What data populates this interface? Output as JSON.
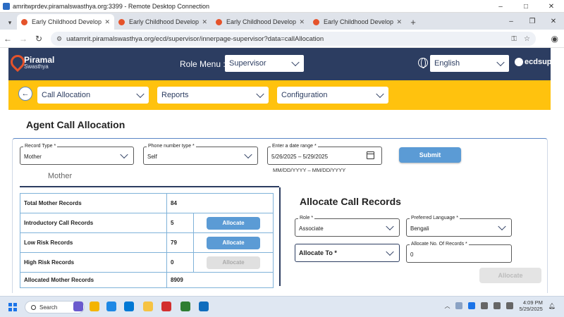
{
  "rdp": {
    "title": "amritwprdev.piramalswasthya.org:3399 - Remote Desktop Connection",
    "controls": [
      "–",
      "□",
      "✕"
    ]
  },
  "browser": {
    "tabs": [
      {
        "label": "Early Childhood Development",
        "active": true
      },
      {
        "label": "Early Childhood Development",
        "active": false
      },
      {
        "label": "Early Childhood Development",
        "active": false
      },
      {
        "label": "Early Childhood Development",
        "active": false
      }
    ],
    "new_tab": "+",
    "url": "uatamrit.piramalswasthya.org/ecd/supervisor/innerpage-supervisor?data=callAllocation"
  },
  "header": {
    "logo_line1": "Piramal",
    "logo_line2": "Swasthya",
    "role_label": "Role Menu :",
    "role_value": "Supervisor",
    "language_value": "English",
    "user": "ecdsupe"
  },
  "nav": {
    "call_allocation": "Call Allocation",
    "reports": "Reports",
    "configuration": "Configuration"
  },
  "page": {
    "title": "Agent Call Allocation",
    "filters": {
      "record_type_label": "Record Type",
      "record_type_value": "Mother",
      "phone_type_label": "Phone number type",
      "phone_type_value": "Self",
      "date_range_label": "Enter a date range",
      "date_range_value": "5/26/2025 – 5/29/2025",
      "date_hint": "MM/DD/YYYY – MM/DD/YYYY",
      "submit": "Submit"
    },
    "tab_label": "Mother",
    "stats": [
      {
        "label": "Total Mother Records",
        "value": "84",
        "action": null
      },
      {
        "label": "Introductory Call Records",
        "value": "5",
        "action": "Allocate",
        "enabled": true
      },
      {
        "label": "Low Risk Records",
        "value": "79",
        "action": "Allocate",
        "enabled": true
      },
      {
        "label": "High Risk Records",
        "value": "0",
        "action": "Allocate",
        "enabled": false
      },
      {
        "label": "Allocated Mother Records",
        "value": "8909",
        "action": null
      }
    ],
    "allocate": {
      "title": "Allocate Call Records",
      "role_label": "Role",
      "role_value": "Associate",
      "language_label": "Preferred Language",
      "language_value": "Bengali",
      "allocate_to_label": "Allocate To",
      "count_label": "Allocate No. Of Records",
      "count_value": "0",
      "button": "Allocate"
    }
  },
  "taskbar": {
    "search": "Search",
    "time": "4:09 PM",
    "date": "5/29/2025",
    "app_colors": [
      "#6a5acd",
      "#f4b400",
      "#1e88e5",
      "#0078d4",
      "#f6c343",
      "#d32f2f",
      "#2e7d32",
      "#0f6cbd",
      "#7b1fa2",
      "#1565c0"
    ]
  },
  "colors": {
    "header_navy": "#2c3d61",
    "nav_yellow": "#ffc20e",
    "button_blue": "#5b9bd5",
    "brand_orange": "#e5532b"
  }
}
